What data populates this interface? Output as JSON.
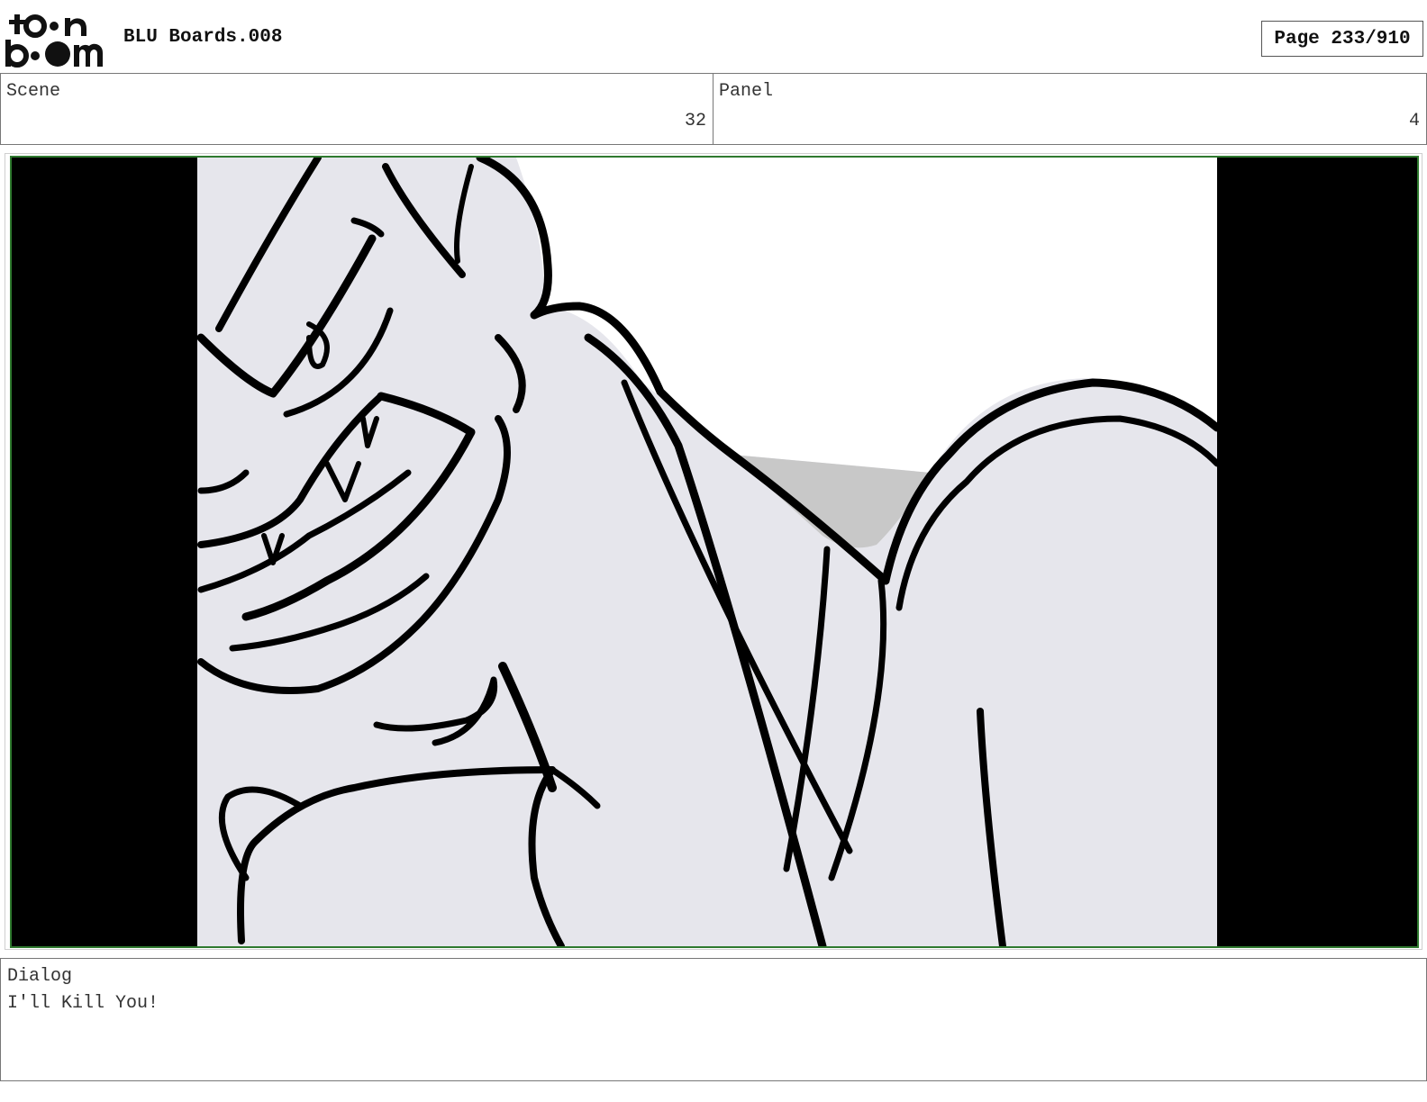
{
  "header": {
    "logo_text": "toonboom",
    "title": "BLU Boards.008",
    "page_label": "Page 233/910"
  },
  "meta": {
    "scene_label": "Scene",
    "scene_value": "32",
    "panel_label": "Panel",
    "panel_value": "4"
  },
  "frame": {
    "image_name": "storyboard-sketch",
    "colors": {
      "border": "#2f7a2f",
      "sketch_bg": "#e6e6ec",
      "letterbox": "#000000",
      "line": "#000000"
    }
  },
  "dialog": {
    "label": "Dialog",
    "text": "I'll Kill You!"
  }
}
